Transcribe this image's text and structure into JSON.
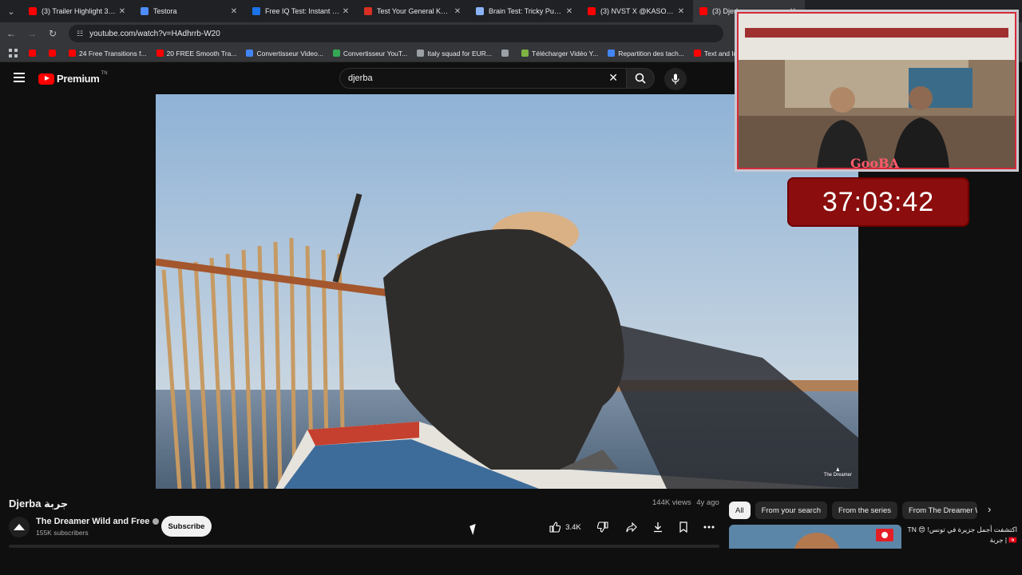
{
  "browser": {
    "tabs": [
      {
        "title": "(3) Trailer Highlight 3 - You",
        "favicon_color": "#ff0000",
        "active": false
      },
      {
        "title": "Testora",
        "favicon_color": "#4f8cff",
        "active": false
      },
      {
        "title": "Free IQ Test: Instant Score",
        "favicon_color": "#1a73e8",
        "active": false
      },
      {
        "title": "Test Your General Knowledge",
        "favicon_color": "#d93025",
        "active": false
      },
      {
        "title": "Brain Test: Tricky Puzzles -",
        "favicon_color": "#8ab4f8",
        "active": false
      },
      {
        "title": "(3) NVST X @KASOKARIM",
        "favicon_color": "#ff0000",
        "active": false
      },
      {
        "title": "(3) Djerba",
        "favicon_color": "#ff0000",
        "active": true
      }
    ],
    "url": "youtube.com/watch?v=HAdhrrb-W20",
    "bookmarks": [
      {
        "label": "",
        "color": "#ff0000"
      },
      {
        "label": "",
        "color": "#ff0000"
      },
      {
        "label": "24 Free Transitions f...",
        "color": "#ff0000"
      },
      {
        "label": "20 FREE Smooth Tra...",
        "color": "#ff0000"
      },
      {
        "label": "Convertisseur Video...",
        "color": "#4285f4"
      },
      {
        "label": "Convertisseur YouT...",
        "color": "#34a853"
      },
      {
        "label": "Italy squad for EUR...",
        "color": "#9aa0a6"
      },
      {
        "label": "",
        "color": "#9aa0a6"
      },
      {
        "label": "Télécharger Vidéo Y...",
        "color": "#7cb342"
      },
      {
        "label": "Repartition des tach...",
        "color": "#4285f4"
      },
      {
        "label": "Text and Image ani...",
        "color": "#ff0000"
      }
    ]
  },
  "youtube": {
    "logo_text": "Premium",
    "country": "TN",
    "search_value": "djerba",
    "video_title": "Djerba جربة",
    "views": "144K views",
    "age": "4y ago",
    "channel": "The Dreamer Wild and Free",
    "subscribers": "155K subscribers",
    "subscribe_label": "Subscribe",
    "likes": "3.4K",
    "watermark": "The Dreamer",
    "chips": [
      "All",
      "From your search",
      "From the series",
      "From The Dreamer W"
    ],
    "rec_title": "اكتشفت أجمل جزيرة في تونس! 😍 TN 🇹🇳 | جربة"
  },
  "overlay": {
    "timer": "37:03:42",
    "webcam_label": "GooBA"
  }
}
